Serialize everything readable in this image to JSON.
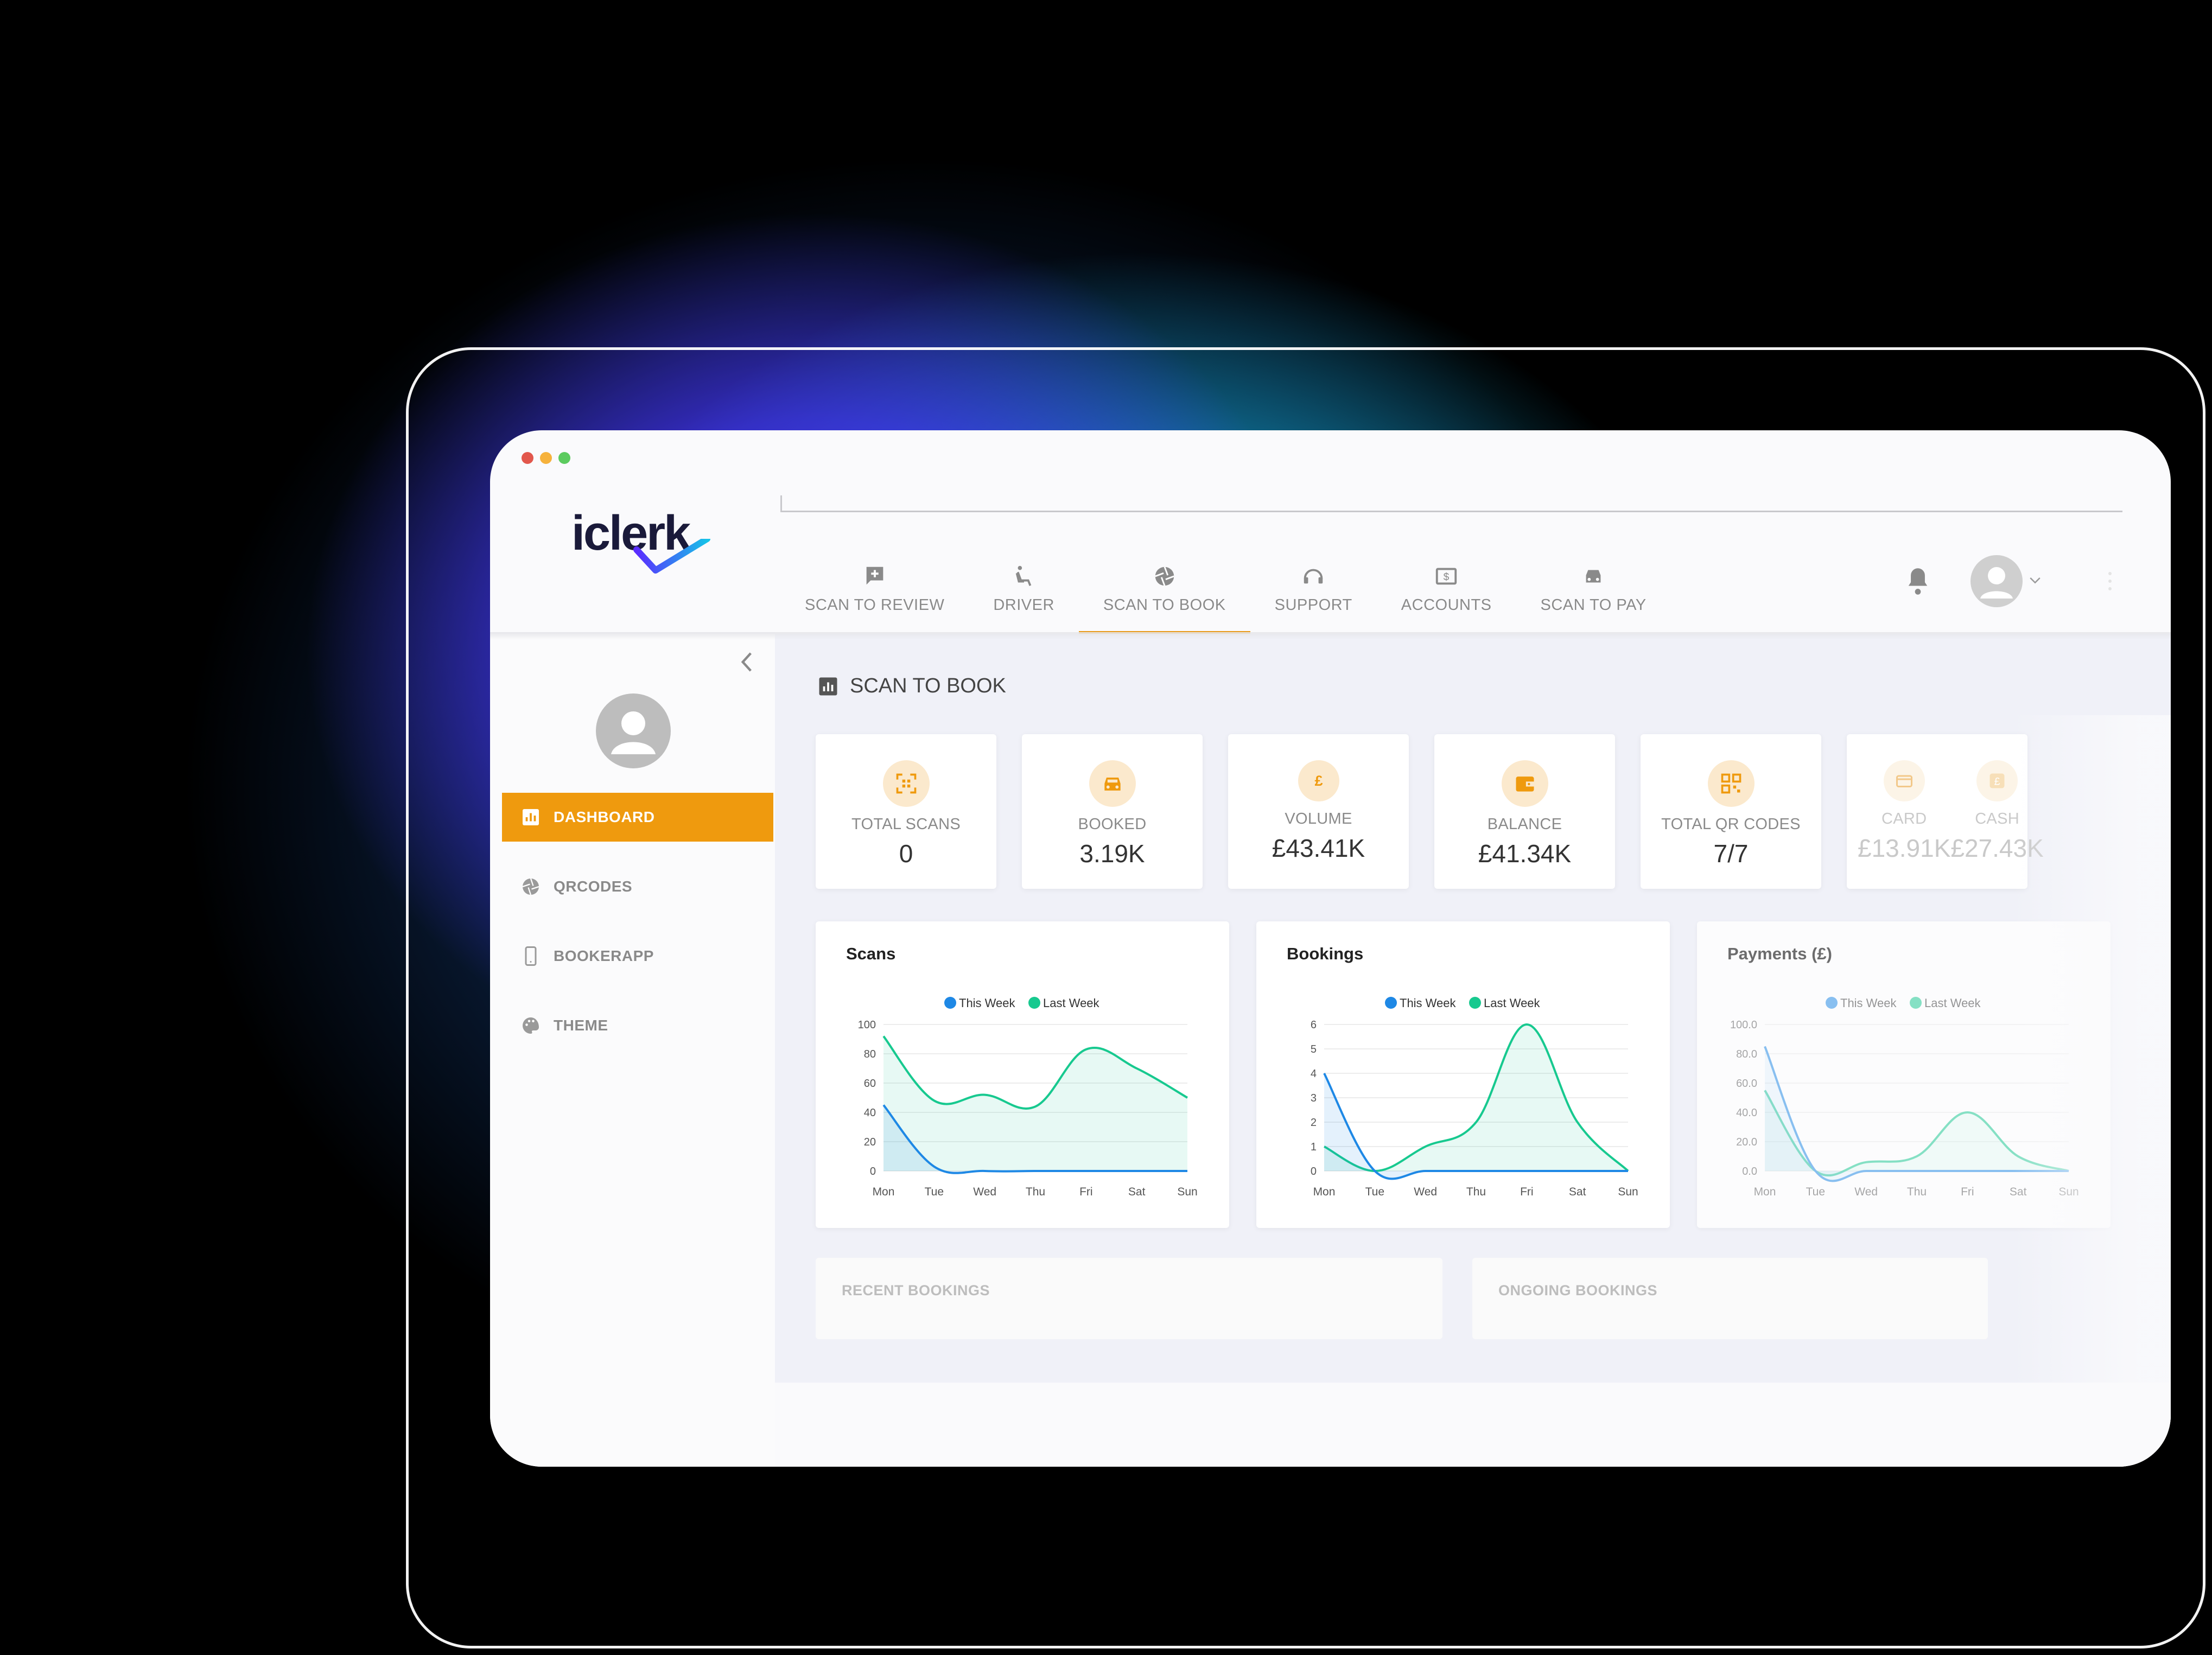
{
  "app": {
    "logo_text": "iclerk",
    "window_dots": [
      "#e2574c",
      "#f6b23c",
      "#5ccb5f"
    ]
  },
  "colors": {
    "accent": "#ef9a0e",
    "this_week": "#1e88e5",
    "last_week": "#17c98f"
  },
  "nav": {
    "tabs": [
      {
        "label": "SCAN TO REVIEW",
        "icon": "message-plus-icon"
      },
      {
        "label": "DRIVER",
        "icon": "seat-icon"
      },
      {
        "label": "SCAN TO BOOK",
        "icon": "aperture-icon",
        "active": true
      },
      {
        "label": "SUPPORT",
        "icon": "headset-icon"
      },
      {
        "label": "ACCOUNTS",
        "icon": "money-icon"
      },
      {
        "label": "SCAN TO PAY",
        "icon": "taxi-icon"
      }
    ]
  },
  "sidebar": {
    "items": [
      {
        "label": "DASHBOARD",
        "icon": "bar-chart-icon",
        "active": true
      },
      {
        "label": "QRCODES",
        "icon": "aperture-icon"
      },
      {
        "label": "BOOKERAPP",
        "icon": "phone-icon"
      },
      {
        "label": "THEME",
        "icon": "palette-icon"
      }
    ]
  },
  "page": {
    "title": "SCAN TO BOOK"
  },
  "stats": [
    {
      "label": "TOTAL SCANS",
      "value": "0",
      "icon": "qr-scan-icon"
    },
    {
      "label": "BOOKED",
      "value": "3.19K",
      "icon": "car-icon"
    },
    {
      "label": "VOLUME",
      "value": "£43.41K",
      "icon": "pound-icon"
    },
    {
      "label": "BALANCE",
      "value": "£41.34K",
      "icon": "wallet-icon"
    },
    {
      "label": "TOTAL QR CODES",
      "value": "7/7",
      "icon": "qr-code-icon"
    },
    {
      "label": "CARD",
      "value": "£13.91K",
      "icon": "card-icon"
    },
    {
      "label": "CASH",
      "value": "£27.43K",
      "icon": "pound-icon"
    }
  ],
  "bottom": {
    "recent": "RECENT BOOKINGS",
    "ongoing": "ONGOING BOOKINGS"
  },
  "chart_data": [
    {
      "type": "area",
      "title": "Scans",
      "categories": [
        "Mon",
        "Tue",
        "Wed",
        "Thu",
        "Fri",
        "Sat",
        "Sun"
      ],
      "ylim": [
        0,
        100
      ],
      "yticks": [
        "0",
        "20",
        "40",
        "60",
        "80",
        "100"
      ],
      "series": [
        {
          "name": "This Week",
          "values": [
            45,
            3,
            0,
            0,
            0,
            0,
            0
          ]
        },
        {
          "name": "Last Week",
          "values": [
            92,
            48,
            52,
            44,
            83,
            70,
            50
          ]
        }
      ],
      "legend": "top-center",
      "grid": true
    },
    {
      "type": "area",
      "title": "Bookings",
      "categories": [
        "Mon",
        "Tue",
        "Wed",
        "Thu",
        "Fri",
        "Sat",
        "Sun"
      ],
      "ylim": [
        0,
        6
      ],
      "yticks": [
        "0",
        "1",
        "2",
        "3",
        "4",
        "5",
        "6"
      ],
      "series": [
        {
          "name": "This Week",
          "values": [
            4,
            0,
            0,
            0,
            0,
            0,
            0
          ]
        },
        {
          "name": "Last Week",
          "values": [
            1,
            0,
            1,
            2,
            6,
            2,
            0
          ]
        }
      ],
      "legend": "top-center",
      "grid": true
    },
    {
      "type": "area",
      "title": "Payments (£)",
      "categories": [
        "Mon",
        "Tue",
        "Wed",
        "Thu",
        "Fri",
        "Sat",
        "Sun"
      ],
      "ylim": [
        0,
        100
      ],
      "yticks": [
        "0.0",
        "20.0",
        "40.0",
        "60.0",
        "80.0",
        "100.0"
      ],
      "series": [
        {
          "name": "This Week",
          "values": [
            85,
            0,
            0,
            0,
            0,
            0,
            0
          ]
        },
        {
          "name": "Last Week",
          "values": [
            55,
            0,
            6,
            10,
            40,
            10,
            0
          ]
        }
      ],
      "legend": "top-center",
      "grid": true
    }
  ]
}
